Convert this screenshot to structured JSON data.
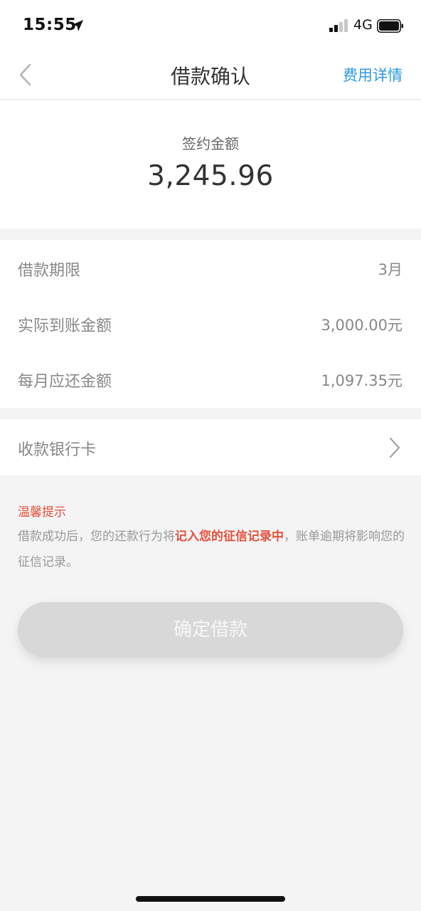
{
  "status_bar": {
    "time": "15:55",
    "network": "4G",
    "location_icon": "location-arrow-icon",
    "signal_icon": "cellular-signal-icon",
    "battery_icon": "battery-icon"
  },
  "nav": {
    "title": "借款确认",
    "back_icon": "chevron-left-icon",
    "right_link": "费用详情",
    "accent_color": "#2c9ae0"
  },
  "amount": {
    "label": "签约金额",
    "value": "3,245.96"
  },
  "details": [
    {
      "label": "借款期限",
      "value": "3月"
    },
    {
      "label": "实际到账金额",
      "value": "3,000.00元"
    },
    {
      "label": "每月应还金额",
      "value": "1,097.35元"
    }
  ],
  "bank": {
    "label": "收款银行卡",
    "chevron_icon": "chevron-right-icon"
  },
  "tips": {
    "title": "温馨提示",
    "text_before": "借款成功后，您的还款行为将",
    "text_highlight": "记入您的征信记录中",
    "text_after": "，账单逾期将影响您的征信记录。",
    "highlight_color": "#e4513d"
  },
  "confirm_button": {
    "label": "确定借款",
    "state": "disabled"
  }
}
